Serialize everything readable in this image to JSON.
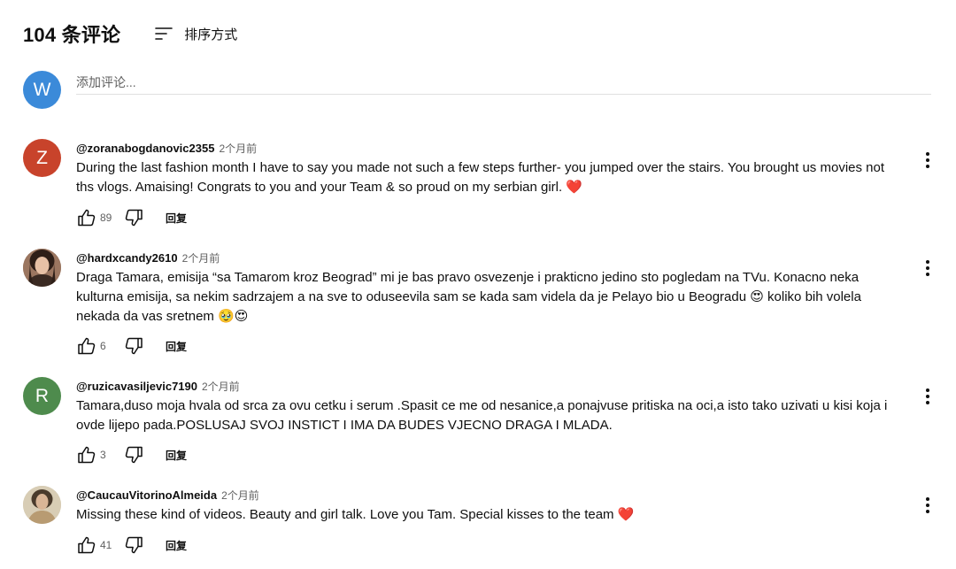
{
  "header": {
    "count_label": "104 条评论",
    "sort_label": "排序方式"
  },
  "add_comment": {
    "avatar_letter": "W",
    "avatar_color": "#3b8ad9",
    "placeholder": "添加评论..."
  },
  "comments": [
    {
      "author": "@zoranabogdanovic2355",
      "time": "2个月前",
      "avatar_letter": "Z",
      "avatar_color": "#c8432b",
      "text": "During the last fashion month I have to say you made not such a few steps further- you jumped over the stairs. You brought us movies not ths vlogs. Amaising! Congrats to you and your Team & so proud on my serbian girl. ❤️",
      "likes": "89",
      "reply_label": "回复"
    },
    {
      "author": "@hardxcandy2610",
      "time": "2个月前",
      "avatar_icon": "profile-photo",
      "text": "Draga Tamara, emisija “sa Tamarom kroz Beograd” mi je bas pravo osvezenje i prakticno jedino sto pogledam na TVu. Konacno neka kulturna emisija, sa nekim sadrzajem a na sve to oduseevila sam se kada sam videla da je Pelayo bio u Beogradu 😍 koliko bih volela nekada da vas sretnem 🥹😍",
      "likes": "6",
      "reply_label": "回复"
    },
    {
      "author": "@ruzicavasiljevic7190",
      "time": "2个月前",
      "avatar_letter": "R",
      "avatar_color": "#4e8b4d",
      "text": "Tamara,duso moja hvala od srca za ovu cetku i serum .Spasit ce me od nesanice,a ponajvuse pritiska na oci,a isto tako uzivati u kisi koja i ovde lijepo pada.POSLUSAJ SVOJ INSTICT I IMA DA BUDES VJECNO DRAGA I MLADA.",
      "likes": "3",
      "reply_label": "回复"
    },
    {
      "author": "@CaucauVitorinoAlmeida",
      "time": "2个月前",
      "avatar_icon": "profile-photo",
      "text": "Missing these kind of videos. Beauty and girl talk. Love you Tam. Special kisses to the team ❤️",
      "likes": "41",
      "reply_label": "回复"
    }
  ],
  "icons": {
    "sort": "sort-lines-icon",
    "like": "thumbs-up-icon",
    "dislike": "thumbs-down-icon",
    "more": "more-vertical-icon"
  }
}
